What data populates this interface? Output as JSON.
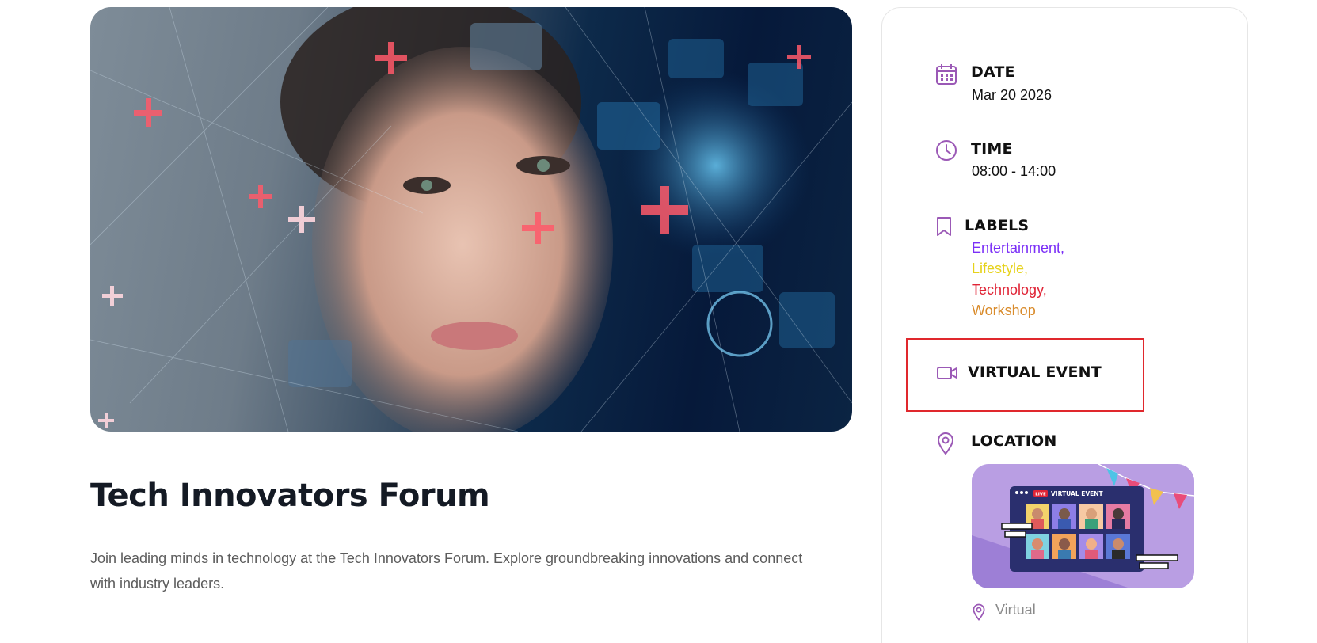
{
  "event": {
    "title": "Tech Innovators Forum",
    "description": "Join leading minds in technology at the Tech Innovators Forum. Explore groundbreaking innovations and connect with industry leaders."
  },
  "info": {
    "date_heading": "DATE",
    "date_value": "Mar 20 2026",
    "time_heading": "TIME",
    "time_value": "08:00 - 14:00",
    "labels_heading": "LABELS",
    "labels": [
      {
        "text": "Entertainment,",
        "color": "#7b2ff7"
      },
      {
        "text": "Lifestyle,",
        "color": "#e6d21a"
      },
      {
        "text": "Technology,",
        "color": "#e02436"
      },
      {
        "text": "Workshop",
        "color": "#d98b2b"
      }
    ],
    "virtual_heading": "VIRTUAL EVENT",
    "location_heading": "LOCATION",
    "location_value": "Virtual",
    "thumb_badge": "LIVE",
    "thumb_caption": "VIRTUAL EVENT"
  },
  "colors": {
    "accent": "#9b59b6",
    "highlight_border": "#e0282d"
  },
  "icons": [
    "calendar-icon",
    "clock-icon",
    "bookmark-icon",
    "video-camera-icon",
    "map-pin-icon"
  ]
}
